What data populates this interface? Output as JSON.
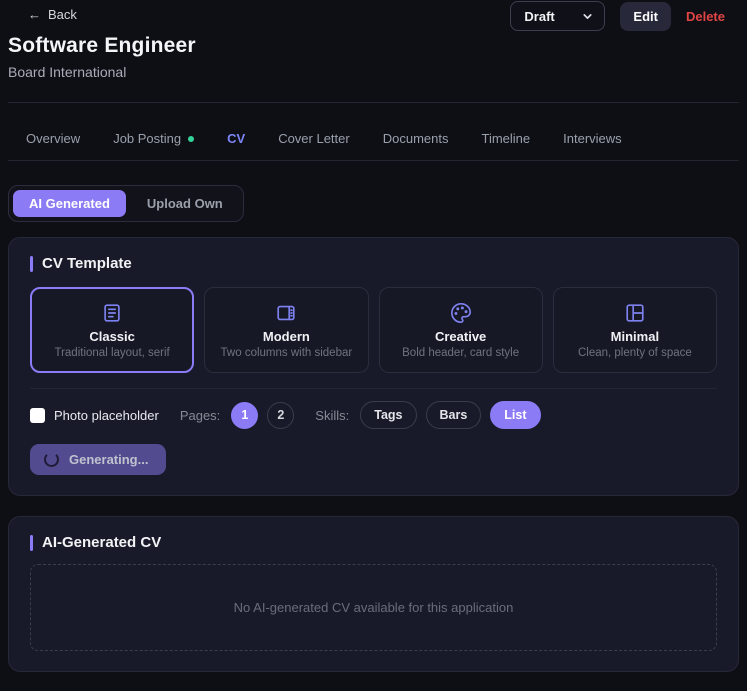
{
  "header": {
    "back_arrow": "←",
    "back_label": "Back",
    "title": "Software Engineer",
    "company": "Board International",
    "status_value": "Draft",
    "edit_label": "Edit",
    "delete_label": "Delete"
  },
  "tabs": {
    "items": [
      {
        "label": "Overview",
        "active": false
      },
      {
        "label": "Job Posting",
        "active": false,
        "has_indicator_dot": true
      },
      {
        "label": "CV",
        "active": true
      },
      {
        "label": "Cover Letter",
        "active": false
      },
      {
        "label": "Documents",
        "active": false
      },
      {
        "label": "Timeline",
        "active": false
      },
      {
        "label": "Interviews",
        "active": false
      }
    ]
  },
  "mode_toggle": {
    "options": [
      {
        "label": "AI Generated",
        "active": true
      },
      {
        "label": "Upload Own",
        "active": false
      }
    ]
  },
  "cv_template": {
    "title": "CV Template",
    "templates": [
      {
        "name": "Classic",
        "description": "Traditional layout, serif",
        "icon": "document-lines-icon",
        "selected": true
      },
      {
        "name": "Modern",
        "description": "Two columns with sidebar",
        "icon": "panel-right-icon",
        "selected": false
      },
      {
        "name": "Creative",
        "description": "Bold header, card style",
        "icon": "palette-icon",
        "selected": false
      },
      {
        "name": "Minimal",
        "description": "Clean, plenty of space",
        "icon": "layout-icon",
        "selected": false
      }
    ],
    "options": {
      "photo_label": "Photo placeholder",
      "photo_checked": false,
      "pages_label": "Pages:",
      "pages": [
        {
          "label": "1",
          "selected": true
        },
        {
          "label": "2",
          "selected": false
        }
      ],
      "skills_label": "Skills:",
      "skills": [
        {
          "label": "Tags",
          "selected": false
        },
        {
          "label": "Bars",
          "selected": false
        },
        {
          "label": "List",
          "selected": true
        }
      ]
    },
    "generate_button": {
      "label": "Generating...",
      "state": "loading"
    }
  },
  "ai_cv": {
    "title": "AI-Generated CV",
    "empty_message": "No AI-generated CV available for this application"
  },
  "colors": {
    "accent_purple": "#8b7cf6",
    "active_tab": "#7d86f6",
    "delete_red": "#e04545",
    "indicator_green": "#34d399",
    "page_background": "#0e0f15",
    "panel_background": "#191a29"
  }
}
